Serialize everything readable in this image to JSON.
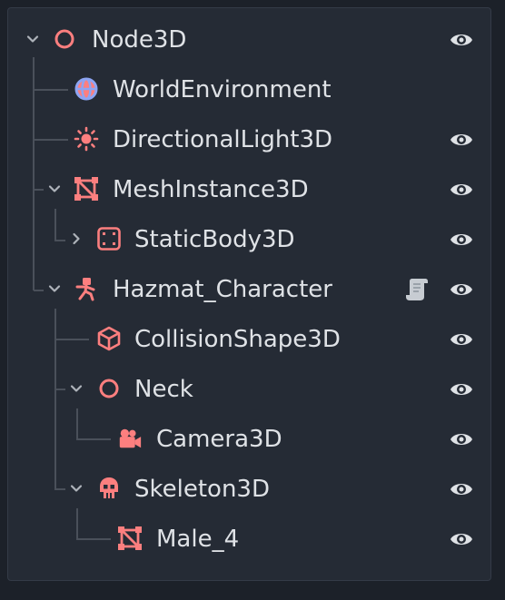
{
  "scene_tree": {
    "nodes": [
      {
        "label": "Node3D",
        "icon": "circle-node-icon",
        "expanded": true,
        "visible": true,
        "has_script": false
      },
      {
        "label": "WorldEnvironment",
        "icon": "globe-icon",
        "visible": false,
        "has_script": false
      },
      {
        "label": "DirectionalLight3D",
        "icon": "sun-icon",
        "visible": true,
        "has_script": false
      },
      {
        "label": "MeshInstance3D",
        "icon": "mesh-icon",
        "expanded": true,
        "visible": true,
        "has_script": false
      },
      {
        "label": "StaticBody3D",
        "icon": "static-body-icon",
        "expanded": false,
        "visible": true,
        "has_script": false
      },
      {
        "label": "Hazmat_Character",
        "icon": "character-body-icon",
        "expanded": true,
        "visible": true,
        "has_script": true
      },
      {
        "label": "CollisionShape3D",
        "icon": "cube-icon",
        "visible": true,
        "has_script": false
      },
      {
        "label": "Neck",
        "icon": "circle-node-icon",
        "expanded": true,
        "visible": true,
        "has_script": false
      },
      {
        "label": "Camera3D",
        "icon": "camera-icon",
        "visible": true,
        "has_script": false
      },
      {
        "label": "Skeleton3D",
        "icon": "skull-icon",
        "expanded": true,
        "visible": true,
        "has_script": false
      },
      {
        "label": "Male_4",
        "icon": "mesh-icon",
        "visible": true,
        "has_script": false
      }
    ]
  },
  "colors": {
    "background": "#1c2129",
    "panel": "#252b35",
    "text": "#dfe2e6",
    "node_icon": "#fc7f7f",
    "globe_icon": "#8da5f3",
    "eye_icon": "#dfe2e6",
    "tree_line": "#4a505a"
  }
}
